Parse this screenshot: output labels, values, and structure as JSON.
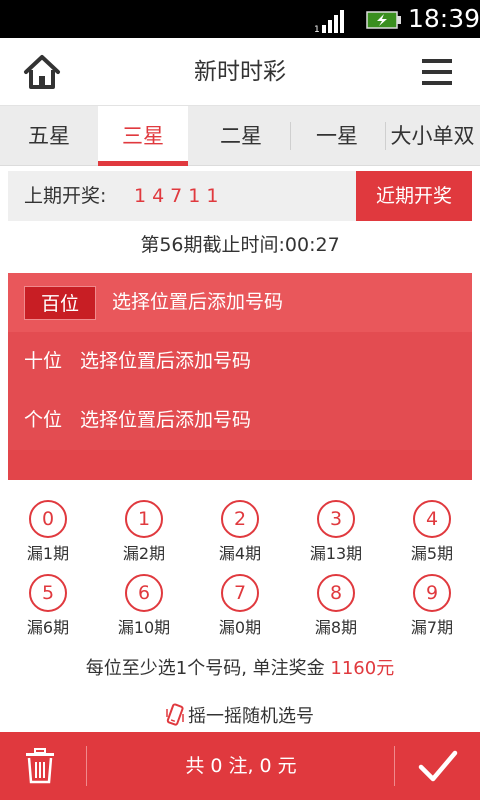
{
  "status_bar": {
    "time": "18:39",
    "signal_icon": "signal-icon",
    "battery_icon": "battery-charging-icon"
  },
  "header": {
    "title": "新时时彩",
    "home_icon": "home-icon",
    "menu_icon": "menu-icon"
  },
  "tabs": [
    {
      "label": "五星",
      "active": false
    },
    {
      "label": "三星",
      "active": true
    },
    {
      "label": "二星",
      "active": false
    },
    {
      "label": "一星",
      "active": false
    },
    {
      "label": "大小单双",
      "active": false
    }
  ],
  "last_draw": {
    "label": "上期开奖:",
    "numbers": "14711",
    "button": "近期开奖"
  },
  "deadline": "第56期截止时间:00:27",
  "positions": [
    {
      "label": "百位",
      "hint": "选择位置后添加号码",
      "selected": true
    },
    {
      "label": "十位",
      "hint": "选择位置后添加号码",
      "selected": false
    },
    {
      "label": "个位",
      "hint": "选择位置后添加号码",
      "selected": false
    }
  ],
  "digits": [
    {
      "digit": "0",
      "miss": "漏1期"
    },
    {
      "digit": "1",
      "miss": "漏2期"
    },
    {
      "digit": "2",
      "miss": "漏4期"
    },
    {
      "digit": "3",
      "miss": "漏13期"
    },
    {
      "digit": "4",
      "miss": "漏5期"
    },
    {
      "digit": "5",
      "miss": "漏6期"
    },
    {
      "digit": "6",
      "miss": "漏10期"
    },
    {
      "digit": "7",
      "miss": "漏0期"
    },
    {
      "digit": "8",
      "miss": "漏8期"
    },
    {
      "digit": "9",
      "miss": "漏7期"
    }
  ],
  "rule": {
    "text": "每位至少选1个号码, 单注奖金 ",
    "prize": "1160元"
  },
  "shake": {
    "text": "摇一摇随机选号",
    "icon": "shake-phone-icon"
  },
  "bottom_bar": {
    "summary": "共 0 注, 0 元",
    "trash_icon": "trash-icon",
    "confirm_icon": "check-icon"
  },
  "colors": {
    "accent": "#e0393e",
    "panel": "#e2454a",
    "chip": "#c81e24"
  }
}
